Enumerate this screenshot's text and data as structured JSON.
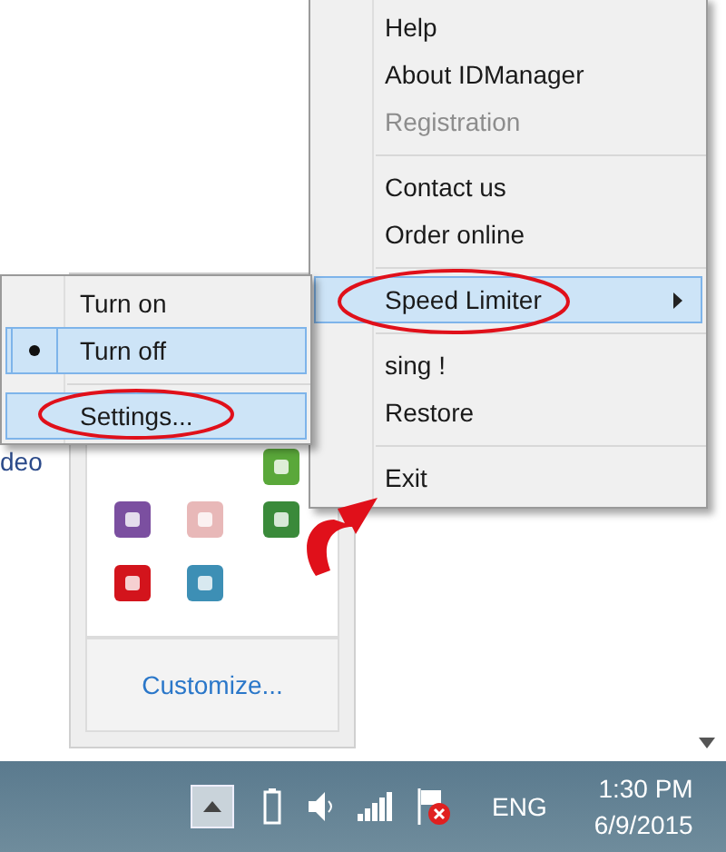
{
  "main_menu": {
    "items": [
      {
        "kind": "item",
        "label": "Help",
        "disabled": false,
        "selected": false
      },
      {
        "kind": "item",
        "label": "About IDManager",
        "disabled": false,
        "selected": false
      },
      {
        "kind": "item",
        "label": "Registration",
        "disabled": true,
        "selected": false
      },
      {
        "kind": "separator"
      },
      {
        "kind": "item",
        "label": "Contact us",
        "disabled": false,
        "selected": false
      },
      {
        "kind": "item",
        "label": "Order online",
        "disabled": false,
        "selected": false
      },
      {
        "kind": "separator"
      },
      {
        "kind": "submenu",
        "label": "Speed Limiter",
        "disabled": false,
        "selected": true
      },
      {
        "kind": "separator"
      },
      {
        "kind": "item",
        "label": "sing !",
        "disabled": false,
        "selected": false
      },
      {
        "kind": "item",
        "label": "Restore",
        "disabled": false,
        "selected": false
      },
      {
        "kind": "separator"
      },
      {
        "kind": "item",
        "label": "Exit",
        "disabled": false,
        "selected": false
      }
    ]
  },
  "speed_submenu": {
    "items": [
      {
        "kind": "radio",
        "label": "Turn on",
        "selected": false
      },
      {
        "kind": "radio",
        "label": "Turn off",
        "selected": true
      },
      {
        "kind": "separator"
      },
      {
        "kind": "item",
        "label": "Settings...",
        "selected": true
      }
    ]
  },
  "background_text": "deo",
  "tray_overflow": {
    "customize_link": "Customize..."
  },
  "taskbar": {
    "language": "ENG",
    "time": "1:30 PM",
    "date": "6/9/2015"
  }
}
